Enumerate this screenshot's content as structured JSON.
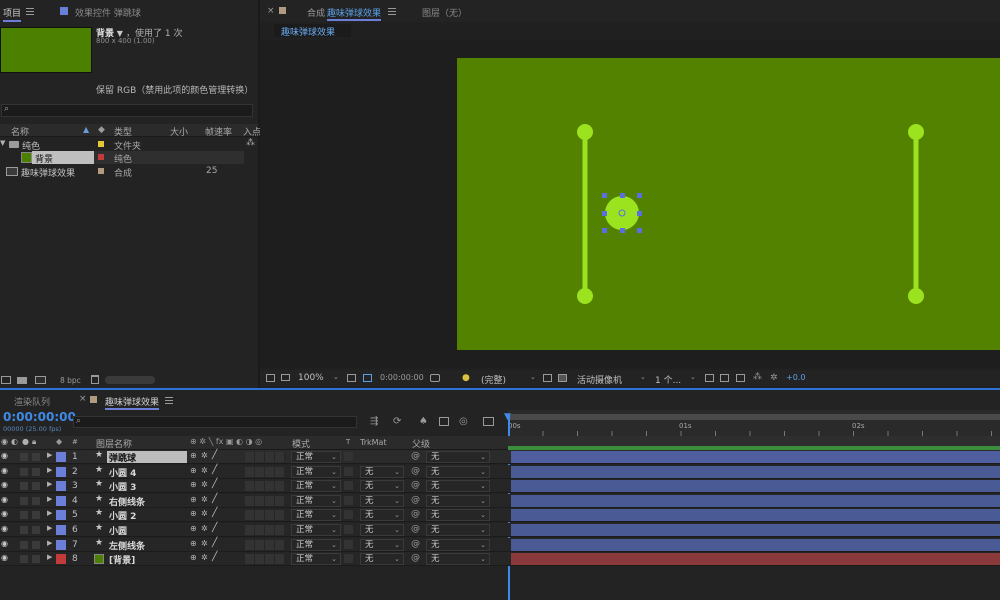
{
  "project_panel": {
    "tab_project": "项目",
    "tab_effects": "效果控件 弹跳球",
    "item_name": "背景",
    "item_used": "，使用了 1 次",
    "item_dims": "800 x 400 (1.00)",
    "item_color_note": "保留 RGB（禁用此项的颜色管理转换）",
    "thumb_color": "#4c8000",
    "search_placeholder": "",
    "columns": [
      "名称",
      "类型",
      "大小",
      "帧速率",
      "入点"
    ],
    "rows": [
      {
        "name": "纯色",
        "type": "文件夹",
        "size": "",
        "fps": "",
        "swatch": "#e4c63a"
      },
      {
        "name": "背景",
        "type": "纯色",
        "size": "",
        "fps": "",
        "swatch": "#c23a3a"
      },
      {
        "name": "趣味弹球效果",
        "type": "合成",
        "size": "",
        "fps": "25",
        "swatch": "#b09a80"
      }
    ],
    "bpc": "8 bpc"
  },
  "comp_panel": {
    "tab_comp": "合成",
    "tab_comp_name": "趣味弹球效果",
    "tab_layer": "图层（无）",
    "breadcrumb": "趣味弹球效果",
    "bg_color": "#528200",
    "accent_color": "#9be21f",
    "zoom": "100%",
    "timecode": "0:00:00:00",
    "resolution": "(完整)",
    "camera": "活动摄像机",
    "views": "1 个...",
    "exposure": "+0.0"
  },
  "timeline_panel": {
    "tab_render": "渲染队列",
    "tab_comp": "趣味弹球效果",
    "timecode": "0:00:00:00",
    "frame_info": "00000 (25.00 fps)",
    "search_placeholder": "",
    "col_layer_name": "图层名称",
    "col_mode": "模式",
    "col_t": "T",
    "col_trkmat": "TrkMat",
    "col_parent": "父级",
    "ruler": [
      "00s",
      "01s",
      "02s"
    ],
    "layers": [
      {
        "num": "1",
        "name": "弹跳球",
        "mode": "正常",
        "trkmat": "",
        "parent": "无",
        "label": "#6b7fd8",
        "bar": "#4f5e9e",
        "selected": true,
        "solid": false
      },
      {
        "num": "2",
        "name": "小圆 4",
        "mode": "正常",
        "trkmat": "无",
        "parent": "无",
        "label": "#6b7fd8",
        "bar": "#4a5a94",
        "selected": false,
        "solid": false
      },
      {
        "num": "3",
        "name": "小圆 3",
        "mode": "正常",
        "trkmat": "无",
        "parent": "无",
        "label": "#6b7fd8",
        "bar": "#4a5a94",
        "selected": false,
        "solid": false
      },
      {
        "num": "4",
        "name": "右侧线条",
        "mode": "正常",
        "trkmat": "无",
        "parent": "无",
        "label": "#6b7fd8",
        "bar": "#4a5a94",
        "selected": false,
        "solid": false
      },
      {
        "num": "5",
        "name": "小圆 2",
        "mode": "正常",
        "trkmat": "无",
        "parent": "无",
        "label": "#6b7fd8",
        "bar": "#4a5a94",
        "selected": false,
        "solid": false
      },
      {
        "num": "6",
        "name": "小圆",
        "mode": "正常",
        "trkmat": "无",
        "parent": "无",
        "label": "#6b7fd8",
        "bar": "#4a5a94",
        "selected": false,
        "solid": false
      },
      {
        "num": "7",
        "name": "左侧线条",
        "mode": "正常",
        "trkmat": "无",
        "parent": "无",
        "label": "#6b7fd8",
        "bar": "#4a5a94",
        "selected": false,
        "solid": false
      },
      {
        "num": "8",
        "name": "[背景]",
        "mode": "正常",
        "trkmat": "无",
        "parent": "无",
        "label": "#c23a3a",
        "bar": "#8a3a3a",
        "selected": false,
        "solid": true
      }
    ]
  }
}
